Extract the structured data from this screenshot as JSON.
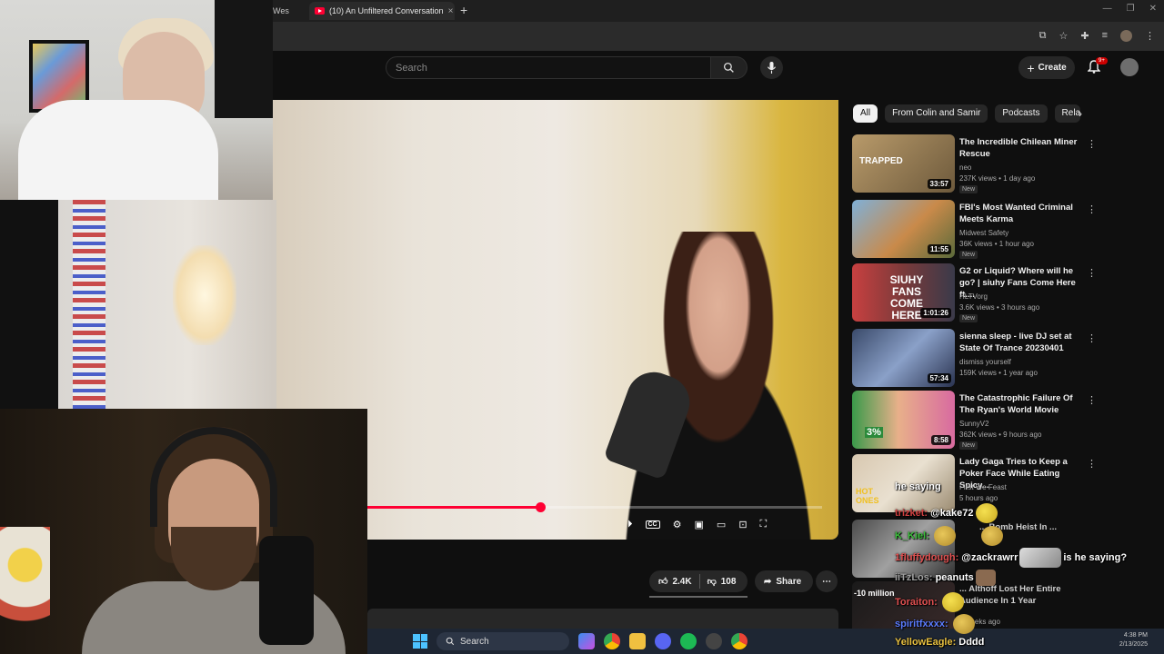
{
  "browser": {
    "tab_prev_label": "Wes",
    "tab_active_title": "(10) An Unfiltered Conversation",
    "tab_close": "×",
    "new_tab": "+"
  },
  "youtube": {
    "search_placeholder": "Search",
    "create_label": "Create",
    "notifications_badge": "9+"
  },
  "chips": [
    "All",
    "From Colin and Samir",
    "Podcasts",
    "Rela"
  ],
  "recommendations": [
    {
      "title": "The Incredible Chilean Miner Rescue",
      "channel": "neo",
      "views": "237K views",
      "age": "1 day ago",
      "badge": "New",
      "duration": "33:57",
      "thumb_text": "TRAPPED"
    },
    {
      "title": "FBI's Most Wanted Criminal Meets Karma",
      "channel": "Midwest Safety",
      "views": "36K views",
      "age": "1 hour ago",
      "badge": "New",
      "duration": "11:55",
      "thumb_text": ""
    },
    {
      "title": "G2 or Liquid? Where will he go? | siuhy Fans Come Here ft....",
      "channel": "HLTVorg",
      "views": "3.6K views",
      "age": "3 hours ago",
      "badge": "New",
      "duration": "1:01:26",
      "thumb_text": "SIUHY FANS COME HERE"
    },
    {
      "title": "sienna sleep - live DJ set at State Of Trance 20230401",
      "channel": "dismiss yourself",
      "views": "159K views",
      "age": "1 year ago",
      "badge": "",
      "duration": "57:34",
      "thumb_text": ""
    },
    {
      "title": "The Catastrophic Failure Of The Ryan's World Movie",
      "channel": "SunnyV2",
      "views": "362K views",
      "age": "9 hours ago",
      "badge": "New",
      "duration": "8:58",
      "thumb_text": "3%"
    },
    {
      "title": "Lady Gaga Tries to Keep a Poker Face While Eating Spicy...",
      "channel": "First We Feast",
      "views": "",
      "age": "5 hours ago",
      "badge": "",
      "duration": "",
      "thumb_text": "HOT ONES"
    },
    {
      "title": "... Bomb Heist In ...",
      "channel": "",
      "views": "",
      "age": "",
      "badge": "",
      "duration": "",
      "thumb_text": ""
    },
    {
      "title": "... Althoff Lost Her Entire Audience In 1 Year",
      "channel": "",
      "views": "",
      "age": "2 weeks ago",
      "badge": "",
      "duration": "",
      "thumb_text": "-10 million"
    }
  ],
  "player": {
    "progress": 0.38,
    "cc_label": "CC"
  },
  "actions": {
    "likes": "2.4K",
    "dislikes": "108",
    "share": "Share",
    "more": "⋯"
  },
  "taskbar": {
    "search_label": "Search",
    "clock_time": "4:38 PM",
    "clock_date": "2/13/2025"
  },
  "chat": [
    {
      "user": "",
      "user_color": "#ffffff",
      "text": "he saying",
      "emotes_after": 0
    },
    {
      "user": "trizket:",
      "user_color": "#d04040",
      "text": "@kake72",
      "emotes_after": 1
    },
    {
      "user": "K_Kiel:",
      "user_color": "#3cc03c",
      "text": "",
      "emotes_after": 2
    },
    {
      "user": "1fluffydough:",
      "user_color": "#e05050",
      "text": "@zackrawrr",
      "emotes_after": 1,
      "text2": "is he saying?"
    },
    {
      "user": "iiTzLos:",
      "user_color": "#a0a0a0",
      "text": "peanuts",
      "emotes_after": 1
    },
    {
      "user": "Toraiton:",
      "user_color": "#e05050",
      "text": "",
      "emotes_after": 1
    },
    {
      "user": "spiritfxxxx:",
      "user_color": "#5b7cff",
      "text": "",
      "emotes_after": 1
    },
    {
      "user": "YellowEagle:",
      "user_color": "#e8c040",
      "text": "Dddd",
      "emotes_after": 0
    }
  ]
}
